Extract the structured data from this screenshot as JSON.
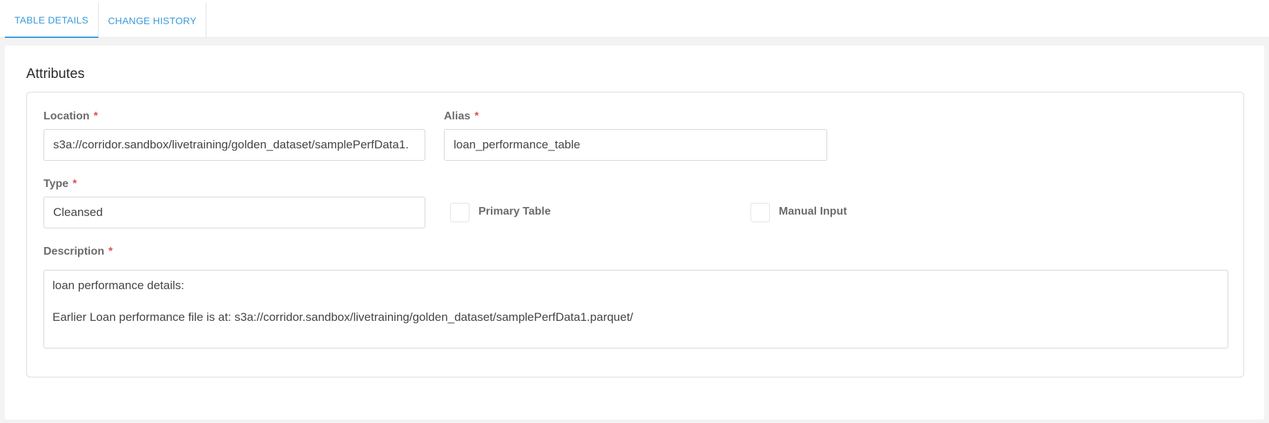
{
  "tabs": {
    "table_details": "TABLE DETAILS",
    "change_history": "CHANGE HISTORY"
  },
  "attributes": {
    "title": "Attributes",
    "required_marker": "*",
    "location": {
      "label": "Location",
      "value": "s3a://corridor.sandbox/livetraining/golden_dataset/samplePerfData1."
    },
    "alias": {
      "label": "Alias",
      "value": "loan_performance_table"
    },
    "type": {
      "label": "Type",
      "value": "Cleansed"
    },
    "primary_table": {
      "label": "Primary Table",
      "checked": false
    },
    "manual_input": {
      "label": "Manual Input",
      "checked": false
    },
    "description": {
      "label": "Description",
      "line1": "loan performance details:",
      "line2": "",
      "line3": "Earlier Loan performance file is at: s3a://corridor.sandbox/livetraining/golden_dataset/samplePerfData1.parquet/"
    }
  },
  "colors": {
    "accent": "#3a9ad9",
    "required": "#d9534f"
  }
}
